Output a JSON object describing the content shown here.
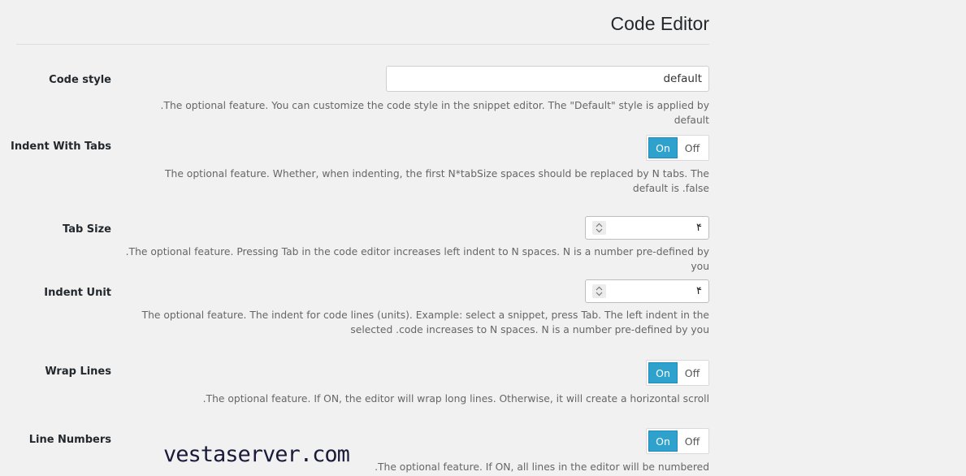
{
  "page": {
    "title": "Code Editor"
  },
  "settings": {
    "code_style": {
      "label": "Code style",
      "value": "default",
      "description": ".The optional feature. You can customize the code style in the snippet editor. The \"Default\" style is applied by default"
    },
    "indent_with_tabs": {
      "label": "Indent With Tabs",
      "on_label": "On",
      "off_label": "Off",
      "description": "The optional feature. Whether, when indenting, the first N*tabSize spaces should be replaced by N tabs. The default is .false"
    },
    "tab_size": {
      "label": "Tab Size",
      "value": "۴",
      "description": ".The optional feature. Pressing Tab in the code editor increases left indent to N spaces. N is a number pre-defined by you"
    },
    "indent_unit": {
      "label": "Indent Unit",
      "value": "۴",
      "description": "The optional feature. The indent for code lines (units). Example: select a snippet, press Tab. The left indent in the selected .code increases to N spaces. N is a number pre-defined by you"
    },
    "wrap_lines": {
      "label": "Wrap Lines",
      "on_label": "On",
      "off_label": "Off",
      "description": ".The optional feature. If ON, the editor will wrap long lines. Otherwise, it will create a horizontal scroll"
    },
    "line_numbers": {
      "label": "Line Numbers",
      "on_label": "On",
      "off_label": "Off",
      "description": ".The optional feature. If ON, all lines in the editor will be numbered"
    }
  },
  "watermark": "vestaserver.com"
}
